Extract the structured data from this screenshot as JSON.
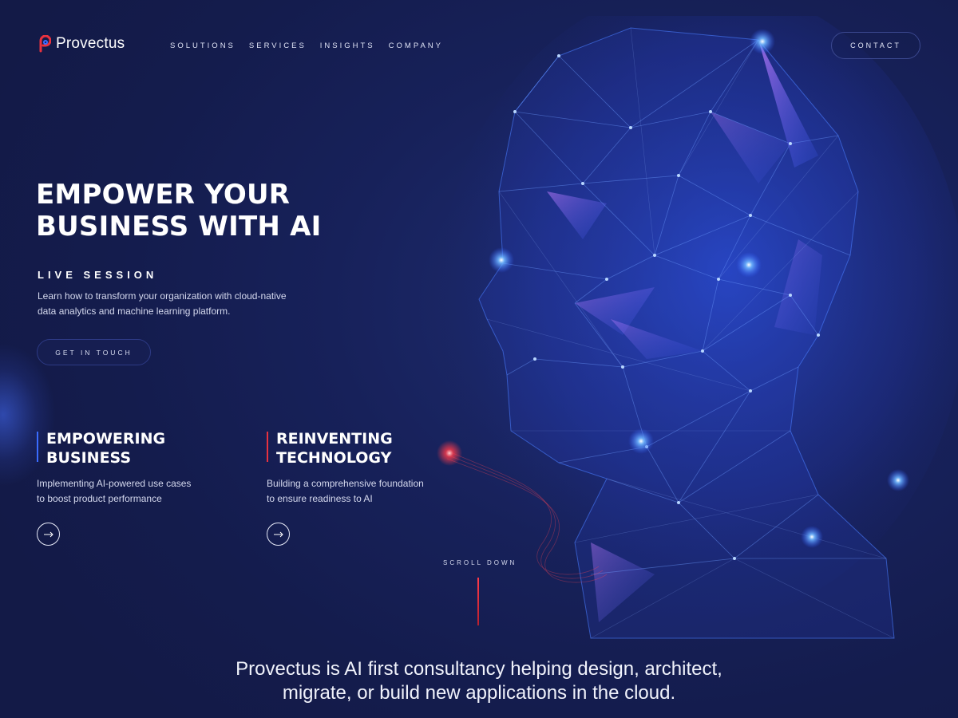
{
  "brand": {
    "name": "Provectus",
    "accent": "#e8323f",
    "background": "#151d4e",
    "mesh": "#3a6cff"
  },
  "nav": {
    "items": [
      {
        "label": "SOLUTIONS"
      },
      {
        "label": "SERVICES"
      },
      {
        "label": "INSIGHTS"
      },
      {
        "label": "COMPANY"
      }
    ],
    "contact_label": "CONTACT"
  },
  "hero": {
    "title": "EMPOWER YOUR BUSINESS WITH AI",
    "live_label": "LIVE SESSION",
    "description": "Learn how to transform your organization with cloud-native data analytics and machine learning platform.",
    "cta_label": "GET IN TOUCH"
  },
  "cards": [
    {
      "title": "EMPOWERING\nBUSINESS",
      "description": "Implementing AI-powered use cases\nto boost product performance",
      "arrow_icon": "arrow-right-icon",
      "bar_color": "#3a6cff"
    },
    {
      "title": "REINVENTING\nTECHNOLOGY",
      "description": "Building a comprehensive foundation\nto ensure readiness to AI",
      "arrow_icon": "arrow-right-icon",
      "bar_color": "#e8323f"
    }
  ],
  "scroll": {
    "label": "SCROLL DOWN"
  },
  "tagline": "Provectus is AI first consultancy helping design, architect,\nmigrate, or build new applications in the cloud."
}
